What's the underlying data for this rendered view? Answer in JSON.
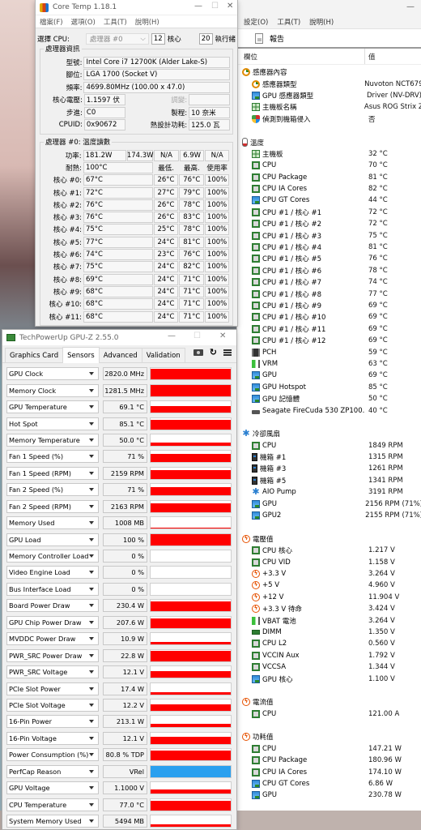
{
  "hwinfo": {
    "menu": [
      "設定(O)",
      "工具(T)",
      "說明(H)"
    ],
    "toolbar_report": "報告",
    "columns": {
      "field": "欄位",
      "value": "值"
    },
    "groups": [
      {
        "title": "感應器內容",
        "icon": "sensor-icon",
        "items": [
          {
            "label": "感應器類型",
            "value": "Nuvoton NCT679",
            "icon": "sensor-icon"
          },
          {
            "label": "GPU 感應器類型",
            "value": "Driver  (NV-DRV)",
            "icon": "gpu-icon"
          },
          {
            "label": "主機板名稱",
            "value": "Asus ROG Strix Z",
            "icon": "motherboard-icon"
          },
          {
            "label": "偵測到機箱侵入",
            "value": "否",
            "icon": "shield-icon"
          }
        ]
      },
      {
        "title": "溫度",
        "icon": "thermometer-icon",
        "items": [
          {
            "label": "主機板",
            "value": "32 °C",
            "icon": "motherboard-icon"
          },
          {
            "label": "CPU",
            "value": "70 °C",
            "icon": "chip-icon"
          },
          {
            "label": "CPU Package",
            "value": "81 °C",
            "icon": "chip-icon"
          },
          {
            "label": "CPU IA Cores",
            "value": "82 °C",
            "icon": "chip-icon"
          },
          {
            "label": "CPU GT Cores",
            "value": "44 °C",
            "icon": "gpu-icon"
          },
          {
            "label": "CPU #1 / 核心 #1",
            "value": "72 °C",
            "icon": "chip-icon"
          },
          {
            "label": "CPU #1 / 核心 #2",
            "value": "72 °C",
            "icon": "chip-icon"
          },
          {
            "label": "CPU #1 / 核心 #3",
            "value": "75 °C",
            "icon": "chip-icon"
          },
          {
            "label": "CPU #1 / 核心 #4",
            "value": "81 °C",
            "icon": "chip-icon"
          },
          {
            "label": "CPU #1 / 核心 #5",
            "value": "76 °C",
            "icon": "chip-icon"
          },
          {
            "label": "CPU #1 / 核心 #6",
            "value": "78 °C",
            "icon": "chip-icon"
          },
          {
            "label": "CPU #1 / 核心 #7",
            "value": "74 °C",
            "icon": "chip-icon"
          },
          {
            "label": "CPU #1 / 核心 #8",
            "value": "77 °C",
            "icon": "chip-icon"
          },
          {
            "label": "CPU #1 / 核心 #9",
            "value": "69 °C",
            "icon": "chip-icon"
          },
          {
            "label": "CPU #1 / 核心 #10",
            "value": "69 °C",
            "icon": "chip-icon"
          },
          {
            "label": "CPU #1 / 核心 #11",
            "value": "69 °C",
            "icon": "chip-icon"
          },
          {
            "label": "CPU #1 / 核心 #12",
            "value": "69 °C",
            "icon": "chip-icon"
          },
          {
            "label": "PCH",
            "value": "59 °C",
            "icon": "pch-icon"
          },
          {
            "label": "VRM",
            "value": "63 °C",
            "icon": "vrm-icon"
          },
          {
            "label": "GPU",
            "value": "69 °C",
            "icon": "gpu-icon"
          },
          {
            "label": "GPU Hotspot",
            "value": "85 °C",
            "icon": "gpu-icon"
          },
          {
            "label": "GPU 記憶體",
            "value": "50 °C",
            "icon": "gpu-icon"
          },
          {
            "label": "Seagate FireCuda 530 ZP100...",
            "value": "40 °C",
            "icon": "disk-icon"
          }
        ]
      },
      {
        "title": "冷卻風扇",
        "icon": "fan-icon",
        "items": [
          {
            "label": "CPU",
            "value": "1849 RPM",
            "icon": "chip-icon"
          },
          {
            "label": "機箱 #1",
            "value": "1315 RPM",
            "icon": "case-icon"
          },
          {
            "label": "機箱 #3",
            "value": "1261 RPM",
            "icon": "case-icon"
          },
          {
            "label": "機箱 #5",
            "value": "1341 RPM",
            "icon": "case-icon"
          },
          {
            "label": "AIO Pump",
            "value": "3191 RPM",
            "icon": "fan-icon"
          },
          {
            "label": "GPU",
            "value": "2156 RPM  (71%)",
            "icon": "gpu-icon"
          },
          {
            "label": "GPU2",
            "value": "2155 RPM  (71%)",
            "icon": "gpu-icon"
          }
        ]
      },
      {
        "title": "電壓值",
        "icon": "voltage-icon",
        "items": [
          {
            "label": "CPU 核心",
            "value": "1.217 V",
            "icon": "chip-icon"
          },
          {
            "label": "CPU VID",
            "value": "1.158 V",
            "icon": "chip-icon"
          },
          {
            "label": "+3.3 V",
            "value": "3.264 V",
            "icon": "voltage-icon"
          },
          {
            "label": "+5 V",
            "value": "4.960 V",
            "icon": "voltage-icon"
          },
          {
            "label": "+12 V",
            "value": "11.904 V",
            "icon": "voltage-icon"
          },
          {
            "label": "+3.3 V 待命",
            "value": "3.424 V",
            "icon": "voltage-icon"
          },
          {
            "label": "VBAT 電池",
            "value": "3.264 V",
            "icon": "vrm-icon"
          },
          {
            "label": "DIMM",
            "value": "1.350 V",
            "icon": "dimm-icon"
          },
          {
            "label": "CPU L2",
            "value": "0.560 V",
            "icon": "chip-icon"
          },
          {
            "label": "VCCIN Aux",
            "value": "1.792 V",
            "icon": "chip-icon"
          },
          {
            "label": "VCCSA",
            "value": "1.344 V",
            "icon": "chip-icon"
          },
          {
            "label": "GPU 核心",
            "value": "1.100 V",
            "icon": "gpu-icon"
          }
        ]
      },
      {
        "title": "電流值",
        "icon": "voltage-icon",
        "items": [
          {
            "label": "CPU",
            "value": "121.00 A",
            "icon": "chip-icon"
          }
        ]
      },
      {
        "title": "功耗值",
        "icon": "voltage-icon",
        "items": [
          {
            "label": "CPU",
            "value": "147.21 W",
            "icon": "chip-icon"
          },
          {
            "label": "CPU Package",
            "value": "180.96 W",
            "icon": "chip-icon"
          },
          {
            "label": "CPU IA Cores",
            "value": "174.10 W",
            "icon": "chip-icon"
          },
          {
            "label": "CPU GT Cores",
            "value": "6.86 W",
            "icon": "gpu-icon"
          },
          {
            "label": "GPU",
            "value": "230.78 W",
            "icon": "gpu-icon"
          }
        ]
      }
    ]
  },
  "coretemp": {
    "title": "Core Temp 1.18.1",
    "menu": [
      "檔案(F)",
      "選項(O)",
      "工具(T)",
      "說明(H)"
    ],
    "select_cpu_label": "選擇 CPU:",
    "select_cpu_value": "處理器 #0",
    "cores_count": "12",
    "cores_label": "核心",
    "threads_count": "20",
    "threads_label": "執行緒",
    "info_legend": "處理器資訊",
    "model_label": "型號:",
    "model": "Intel Core i7 12700K (Alder Lake-S)",
    "socket_label": "腳位:",
    "socket": "LGA 1700 (Socket V)",
    "freq_label": "頻率:",
    "freq": "4699.80MHz (100.00 x 47.0)",
    "vcore_label": "核心電壓:",
    "vcore": "1.1597 伏",
    "mod_label": "調變:",
    "mod": "",
    "stepping_label": "步進:",
    "stepping": "C0",
    "process_label": "製程:",
    "process": "10 奈米",
    "cpuid_label": "CPUID:",
    "cpuid": "0x90672",
    "tdp_label": "熱設計功耗:",
    "tdp": "125.0 瓦",
    "temp_legend": "處理器 #0: 溫度讀數",
    "power_label": "功率:",
    "power": [
      "181.2W",
      "174.3W",
      "N/A",
      "6.9W",
      "N/A"
    ],
    "tjmax_label": "耐熱:",
    "tjmax": "100°C",
    "col_min": "最低.",
    "col_max": "最高.",
    "col_load": "使用率",
    "cores": [
      {
        "label": "核心 #0:",
        "temp": "67°C",
        "min": "26°C",
        "max": "76°C",
        "load": "100%"
      },
      {
        "label": "核心 #1:",
        "temp": "72°C",
        "min": "27°C",
        "max": "79°C",
        "load": "100%"
      },
      {
        "label": "核心 #2:",
        "temp": "76°C",
        "min": "26°C",
        "max": "78°C",
        "load": "100%"
      },
      {
        "label": "核心 #3:",
        "temp": "76°C",
        "min": "26°C",
        "max": "83°C",
        "load": "100%"
      },
      {
        "label": "核心 #4:",
        "temp": "75°C",
        "min": "25°C",
        "max": "78°C",
        "load": "100%"
      },
      {
        "label": "核心 #5:",
        "temp": "77°C",
        "min": "24°C",
        "max": "81°C",
        "load": "100%"
      },
      {
        "label": "核心 #6:",
        "temp": "74°C",
        "min": "23°C",
        "max": "76°C",
        "load": "100%"
      },
      {
        "label": "核心 #7:",
        "temp": "75°C",
        "min": "24°C",
        "max": "82°C",
        "load": "100%"
      },
      {
        "label": "核心 #8:",
        "temp": "69°C",
        "min": "24°C",
        "max": "71°C",
        "load": "100%"
      },
      {
        "label": "核心 #9:",
        "temp": "68°C",
        "min": "24°C",
        "max": "71°C",
        "load": "100%"
      },
      {
        "label": "核心 #10:",
        "temp": "68°C",
        "min": "24°C",
        "max": "71°C",
        "load": "100%"
      },
      {
        "label": "核心 #11:",
        "temp": "68°C",
        "min": "24°C",
        "max": "71°C",
        "load": "100%"
      }
    ]
  },
  "gpuz": {
    "title": "TechPowerUp GPU-Z 2.55.0",
    "tabs": [
      "Graphics Card",
      "Sensors",
      "Advanced",
      "Validation"
    ],
    "active_tab": "Sensors",
    "sensors": [
      {
        "name": "GPU Clock",
        "value": "2820.0 MHz",
        "level": 0.95,
        "color": "#ff0000"
      },
      {
        "name": "Memory Clock",
        "value": "1281.5 MHz",
        "level": 0.95,
        "color": "#ff0000"
      },
      {
        "name": "GPU Temperature",
        "value": "69.1 °C",
        "level": 0.55,
        "color": "#ff0000"
      },
      {
        "name": "Hot Spot",
        "value": "85.1 °C",
        "level": 0.85,
        "color": "#ff0000"
      },
      {
        "name": "Memory Temperature",
        "value": "50.0 °C",
        "level": 0.25,
        "color": "#ff0000"
      },
      {
        "name": "Fan 1 Speed (%)",
        "value": "71 %",
        "level": 0.75,
        "color": "#ff0000"
      },
      {
        "name": "Fan 1 Speed (RPM)",
        "value": "2159 RPM",
        "level": 0.75,
        "color": "#ff0000"
      },
      {
        "name": "Fan 2 Speed (%)",
        "value": "71 %",
        "level": 0.75,
        "color": "#ff0000"
      },
      {
        "name": "Fan 2 Speed (RPM)",
        "value": "2163 RPM",
        "level": 0.75,
        "color": "#ff0000"
      },
      {
        "name": "Memory Used",
        "value": "1008 MB",
        "level": 0.08,
        "color": "#ff0000"
      },
      {
        "name": "GPU Load",
        "value": "100 %",
        "level": 1.0,
        "color": "#ff0000"
      },
      {
        "name": "Memory Controller Load",
        "value": "0 %",
        "level": 0,
        "color": "#ff0000"
      },
      {
        "name": "Video Engine Load",
        "value": "0 %",
        "level": 0,
        "color": "#ff0000"
      },
      {
        "name": "Bus Interface Load",
        "value": "0 %",
        "level": 0,
        "color": "#ff0000"
      },
      {
        "name": "Board Power Draw",
        "value": "230.4 W",
        "level": 0.9,
        "color": "#ff0000"
      },
      {
        "name": "GPU Chip Power Draw",
        "value": "207.6 W",
        "level": 0.85,
        "color": "#ff0000"
      },
      {
        "name": "MVDDC Power Draw",
        "value": "10.9 W",
        "level": 0.2,
        "color": "#ff0000"
      },
      {
        "name": "PWR_SRC Power Draw",
        "value": "22.8 W",
        "level": 0.9,
        "color": "#ff0000"
      },
      {
        "name": "PWR_SRC Voltage",
        "value": "12.1 V",
        "level": 0.6,
        "color": "#ff0000"
      },
      {
        "name": "PCIe Slot Power",
        "value": "17.4 W",
        "level": 0.2,
        "color": "#ff0000"
      },
      {
        "name": "PCIe Slot Voltage",
        "value": "12.2 V",
        "level": 0.6,
        "color": "#ff0000"
      },
      {
        "name": "16-Pin Power",
        "value": "213.1 W",
        "level": 0.35,
        "color": "#ff0000"
      },
      {
        "name": "16-Pin Voltage",
        "value": "12.1 V",
        "level": 0.6,
        "color": "#ff0000"
      },
      {
        "name": "Power Consumption (%)",
        "value": "80.8 % TDP",
        "level": 0.85,
        "color": "#ff0000"
      },
      {
        "name": "PerfCap Reason",
        "value": "VRel",
        "level": 1.0,
        "color": "#2aa0ef"
      },
      {
        "name": "GPU Voltage",
        "value": "1.1000 V",
        "level": 0.4,
        "color": "#ff0000"
      },
      {
        "name": "CPU Temperature",
        "value": "77.0 °C",
        "level": 0.8,
        "color": "#ff0000"
      },
      {
        "name": "System Memory Used",
        "value": "5494 MB",
        "level": 0.2,
        "color": "#ff0000"
      }
    ]
  }
}
